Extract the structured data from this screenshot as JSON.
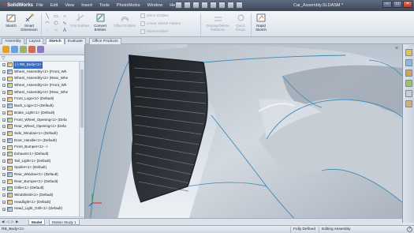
{
  "app": {
    "logo_text": "SolidWorks",
    "document_title": "Car_Assembly.SLDASM *"
  },
  "menu": [
    "File",
    "Edit",
    "View",
    "Insert",
    "Tools",
    "PhotoWorks",
    "Window",
    "Help"
  ],
  "command_manager": {
    "sketch": "Sketch",
    "smart_dimension": "Smart Dimension",
    "trim_entities": "Trim Entities",
    "convert_entities": "Convert Entities",
    "offset_entities": "Offset Entities",
    "mirror_entities": "Mirror Entities",
    "linear_sketch_pattern": "Linear Sketch Pattern",
    "move_entities": "Move Entities",
    "display_delete_relations": "Display/Delete Relations",
    "quick_snaps": "Quick Snaps",
    "rapid_sketch": "Rapid Sketch"
  },
  "command_tabs": [
    "Assembly",
    "Layout",
    "Sketch",
    "Evaluate",
    "Office Products"
  ],
  "active_command_tab": "Sketch",
  "feature_tree": {
    "items": [
      {
        "label": "(-) RB_Body<1>",
        "selected": true,
        "expander": "+"
      },
      {
        "label": "Wheel_Assembly<1> (Front_Wh",
        "expander": "+"
      },
      {
        "label": "Wheel_Assembly<2> (Rear_Whe",
        "expander": "+"
      },
      {
        "label": "Wheel_Assembly<3> (Front_Wh",
        "expander": "+"
      },
      {
        "label": "Wheel_Assembly<4> (Rear_Whe",
        "expander": "+"
      },
      {
        "label": "Front_Logo<1> (Default)",
        "expander": "+"
      },
      {
        "label": "Back_Logo<1> (Default)",
        "expander": "+"
      },
      {
        "label": "Brake_Light<1> (Default)",
        "expander": "+"
      },
      {
        "label": "Front_Wheel_Opening<1> (Defa",
        "expander": "+"
      },
      {
        "label": "Rear_Wheel_Opening<1> (Defa",
        "expander": "+"
      },
      {
        "label": "Side_Window<1> (Default)",
        "expander": "+"
      },
      {
        "label": "Door_Handle<1> (Default)",
        "expander": "+"
      },
      {
        "label": "Front_Bumper<1> ->",
        "expander": "+"
      },
      {
        "label": "Exhaust<1> (Default)",
        "expander": "+"
      },
      {
        "label": "Tail_Light<1> (Default)",
        "expander": "+"
      },
      {
        "label": "Spoiler<1> (Default)",
        "expander": "+"
      },
      {
        "label": "Rear_Window<1> (Default)",
        "expander": "+"
      },
      {
        "label": "Rear_Bumper<1> (Default)",
        "expander": "+"
      },
      {
        "label": "Grille<1> (Default)",
        "expander": "+"
      },
      {
        "label": "Windshield<1> (Default)",
        "expander": "+"
      },
      {
        "label": "Headlight<1> (Default)",
        "expander": "+"
      },
      {
        "label": "Head_Light_Grill<1> (Default)",
        "expander": "+"
      }
    ]
  },
  "bottom_tabs": [
    "Model",
    "Motion Study 1"
  ],
  "active_bottom_tab": "Model",
  "status_bar": {
    "selection": "RB_Body<1>",
    "definition": "Fully Defined",
    "mode": "Editing Assembly",
    "help": "?"
  },
  "colors": {
    "selection_blue": "#3a6dc4",
    "body_gray": "#c5cdd6",
    "edge_blue": "#3d89b8",
    "logo_red": "#e23a2a"
  }
}
